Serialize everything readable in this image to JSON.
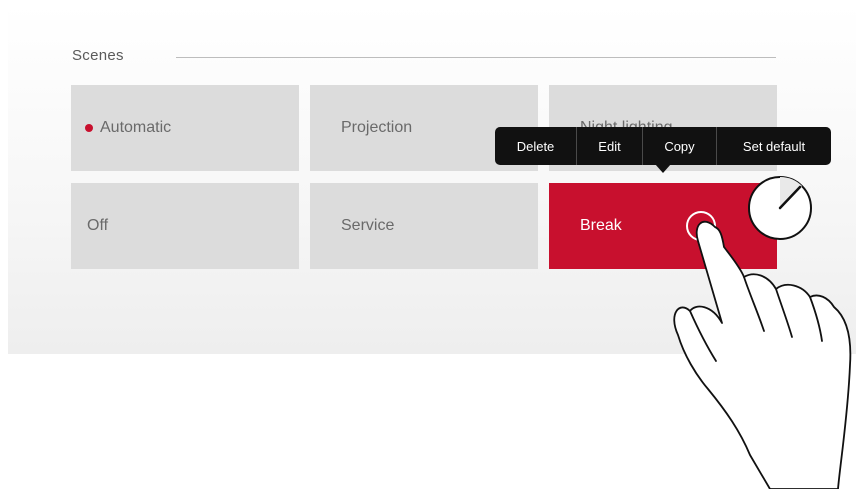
{
  "scenes": {
    "title": "Scenes",
    "tiles": [
      {
        "label": "Automatic"
      },
      {
        "label": "Projection"
      },
      {
        "label": "Night lighting"
      },
      {
        "label": "Off"
      },
      {
        "label": "Service"
      },
      {
        "label": "Break"
      }
    ],
    "active_scene": "Automatic",
    "selected_scene": "Break"
  },
  "context_menu": {
    "items": [
      {
        "label": "Delete"
      },
      {
        "label": "Edit"
      },
      {
        "label": "Copy"
      },
      {
        "label": "Set default"
      }
    ]
  },
  "colors": {
    "accent": "#c8102e",
    "tile": "#dcdcdc",
    "menu": "#111111"
  },
  "icons": [
    "status-dot-icon",
    "long-press-timer-icon",
    "touch-ring-icon",
    "hand-pointer-icon"
  ]
}
